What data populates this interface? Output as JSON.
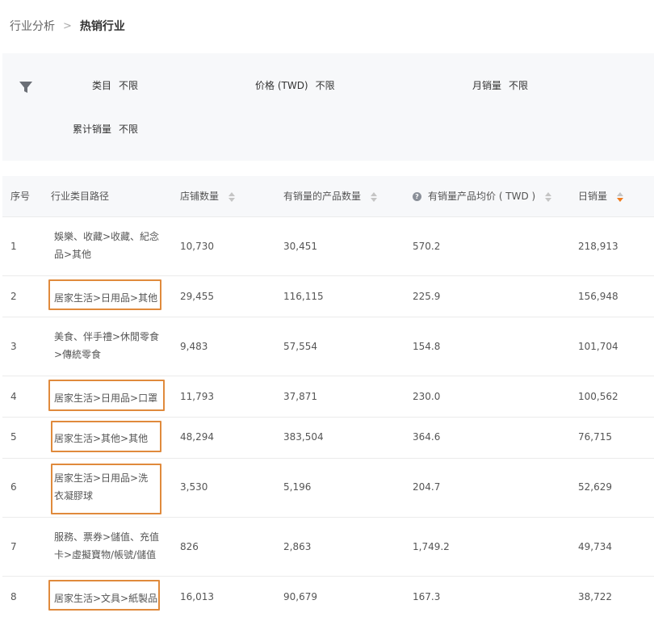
{
  "breadcrumb": {
    "parent": "行业分析",
    "separator": ">",
    "current": "热销行业"
  },
  "filters": {
    "category": {
      "label": "类目",
      "value": "不限"
    },
    "price": {
      "label": "价格 (TWD)",
      "value": "不限"
    },
    "monthly_sales": {
      "label": "月销量",
      "value": "不限"
    },
    "cumulative_sales": {
      "label": "累计销量",
      "value": "不限"
    }
  },
  "table": {
    "headers": {
      "rank": "序号",
      "path": "行业类目路径",
      "stores": "店铺数量",
      "products": "有销量的产品数量",
      "avg_price": "有销量产品均价 ( TWD )",
      "daily_sales": "日销量"
    },
    "rows": [
      {
        "rank": "1",
        "path": "娛樂、收藏>收藏、紀念品>其他",
        "stores": "10,730",
        "products": "30,451",
        "avg_price": "570.2",
        "daily_sales": "218,913"
      },
      {
        "rank": "2",
        "path": "居家生活>日用品>其他",
        "stores": "29,455",
        "products": "116,115",
        "avg_price": "225.9",
        "daily_sales": "156,948"
      },
      {
        "rank": "3",
        "path": "美食、伴手禮>休閒零食>傳統零食",
        "stores": "9,483",
        "products": "57,554",
        "avg_price": "154.8",
        "daily_sales": "101,704"
      },
      {
        "rank": "4",
        "path": "居家生活>日用品>口罩",
        "stores": "11,793",
        "products": "37,871",
        "avg_price": "230.0",
        "daily_sales": "100,562"
      },
      {
        "rank": "5",
        "path": "居家生活>其他>其他",
        "stores": "48,294",
        "products": "383,504",
        "avg_price": "364.6",
        "daily_sales": "76,715"
      },
      {
        "rank": "6",
        "path": "居家生活>日用品>洗衣凝膠球",
        "stores": "3,530",
        "products": "5,196",
        "avg_price": "204.7",
        "daily_sales": "52,629"
      },
      {
        "rank": "7",
        "path": "服務、票券>儲值、充值卡>虛擬寶物/帳號/儲值",
        "stores": "826",
        "products": "2,863",
        "avg_price": "1,749.2",
        "daily_sales": "49,734"
      },
      {
        "rank": "8",
        "path": "居家生活>文具>紙製品",
        "stores": "16,013",
        "products": "90,679",
        "avg_price": "167.3",
        "daily_sales": "38,722"
      }
    ]
  },
  "icons": {
    "filter": "filter-funnel-icon",
    "sort": "sort-icon",
    "help": "help-circle-icon"
  },
  "colors": {
    "highlight": "#e08a3c",
    "sort_active": "#f07c1e"
  }
}
